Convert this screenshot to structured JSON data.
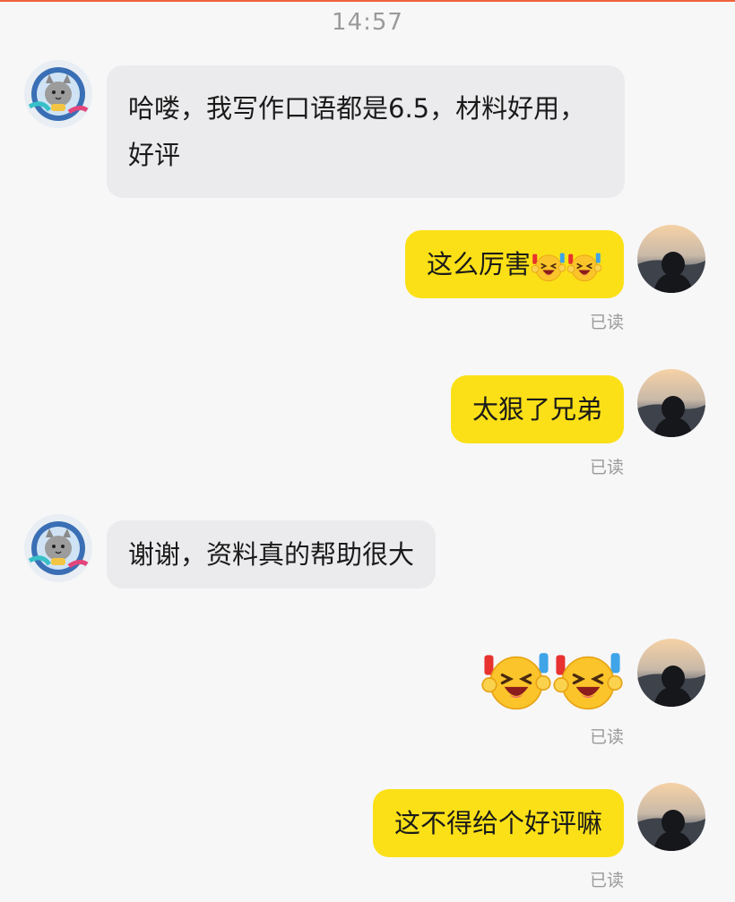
{
  "header": {
    "time": "14:57"
  },
  "messages": [
    {
      "side": "in",
      "text": "哈喽，我写作口语都是6.5，材料好用，好评"
    },
    {
      "side": "out",
      "text": "这么厉害",
      "emoji": [
        "laughing-cheer-emoji",
        "laughing-cheer-emoji"
      ],
      "status": "已读"
    },
    {
      "side": "out",
      "text": "太狠了兄弟",
      "status": "已读"
    },
    {
      "side": "in",
      "text": "谢谢，资料真的帮助很大"
    },
    {
      "side": "out",
      "sticker": [
        "laughing-cheer-emoji",
        "laughing-cheer-emoji"
      ],
      "status": "已读"
    },
    {
      "side": "out",
      "text": "这不得给个好评嘛",
      "status": "已读"
    }
  ],
  "avatars": {
    "contact": "cat-astronaut-avatar",
    "me": "sunset-silhouette-avatar"
  },
  "colors": {
    "bubble_in": "#ebebed",
    "bubble_out": "#fbe017",
    "background": "#f7f7f8",
    "meta_text": "#9a9a9a"
  }
}
